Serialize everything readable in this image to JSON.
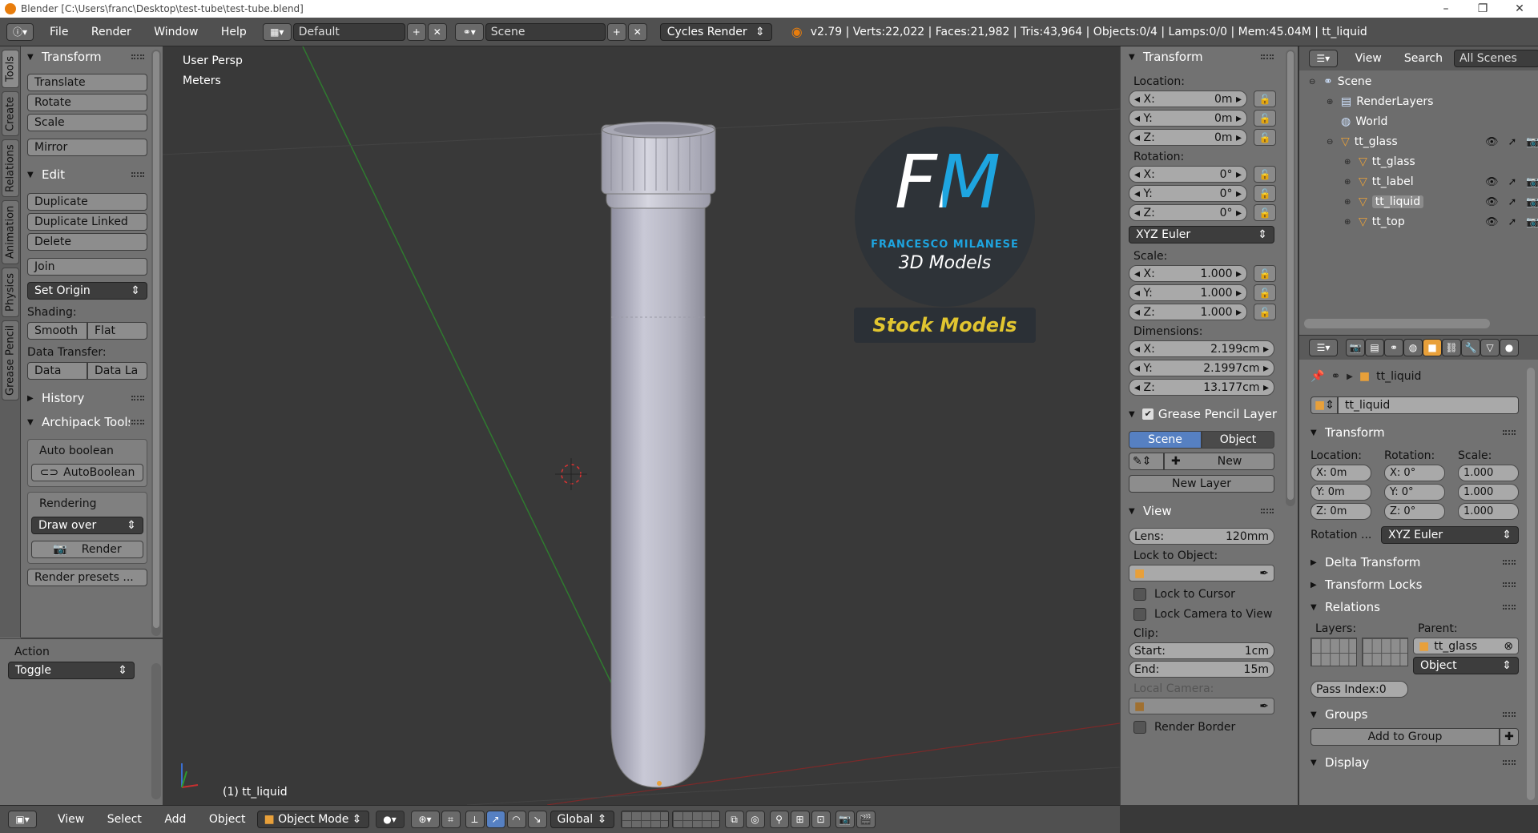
{
  "title_bar": {
    "text": "Blender [C:\\Users\\franc\\Desktop\\test-tube\\test-tube.blend]",
    "minimize": "–",
    "maximize": "❐",
    "close": "✕"
  },
  "info": {
    "menus": [
      "File",
      "Render",
      "Window",
      "Help"
    ],
    "layout": "Default",
    "scene": "Scene",
    "engine": "Cycles Render",
    "stats": "v2.79 | Verts:22,022 | Faces:21,982 | Tris:43,964 | Objects:0/4 | Lamps:0/0 | Mem:45.04M | tt_liquid"
  },
  "tool_tabs": [
    "Tools",
    "Create",
    "Relations",
    "Animation",
    "Physics",
    "Grease Pencil"
  ],
  "toolshelf": {
    "transform": {
      "title": "Transform",
      "buttons": [
        "Translate",
        "Rotate",
        "Scale",
        "Mirror"
      ]
    },
    "edit": {
      "title": "Edit",
      "buttons": [
        "Duplicate",
        "Duplicate Linked",
        "Delete",
        "Join"
      ],
      "set_origin": "Set Origin",
      "shading_label": "Shading:",
      "smooth": "Smooth",
      "flat": "Flat",
      "data_transfer_label": "Data Transfer:",
      "data": "Data",
      "data_la": "Data La"
    },
    "history": "History",
    "archipack": {
      "title": "Archipack Tools",
      "auto_boolean": "Auto boolean",
      "autoboolean_btn": "AutoBoolean",
      "rendering": "Rendering",
      "draw_over": "Draw over",
      "render": "Render",
      "render_presets": "Render presets ..."
    },
    "operator": {
      "title": "Action",
      "value": "Toggle"
    }
  },
  "viewport": {
    "mode_text": "User Persp",
    "units_text": "Meters",
    "object_text": "(1) tt_liquid",
    "logo": {
      "letters": "FM",
      "name": "FRANCESCO MILANESE",
      "sub": "3D Models",
      "stock": "Stock Models"
    }
  },
  "properties_n": {
    "transform_title": "Transform",
    "location_label": "Location:",
    "location": [
      {
        "axis": "X:",
        "value": "0m"
      },
      {
        "axis": "Y:",
        "value": "0m"
      },
      {
        "axis": "Z:",
        "value": "0m"
      }
    ],
    "rotation_label": "Rotation:",
    "rotation": [
      {
        "axis": "X:",
        "value": "0°"
      },
      {
        "axis": "Y:",
        "value": "0°"
      },
      {
        "axis": "Z:",
        "value": "0°"
      }
    ],
    "rotation_mode": "XYZ Euler",
    "scale_label": "Scale:",
    "scale": [
      {
        "axis": "X:",
        "value": "1.000"
      },
      {
        "axis": "Y:",
        "value": "1.000"
      },
      {
        "axis": "Z:",
        "value": "1.000"
      }
    ],
    "dimensions_label": "Dimensions:",
    "dimensions": [
      {
        "axis": "X:",
        "value": "2.199cm"
      },
      {
        "axis": "Y:",
        "value": "2.1997cm"
      },
      {
        "axis": "Z:",
        "value": "13.177cm"
      }
    ],
    "gp_title": "Grease Pencil Layer",
    "gp_scene": "Scene",
    "gp_object": "Object",
    "gp_new": "New",
    "gp_new_layer": "New Layer",
    "view_title": "View",
    "lens_label": "Lens:",
    "lens_value": "120mm",
    "lock_to_object": "Lock to Object:",
    "lock_to_cursor": "Lock to Cursor",
    "lock_camera": "Lock Camera to View",
    "clip_label": "Clip:",
    "clip_start_label": "Start:",
    "clip_start": "1cm",
    "clip_end_label": "End:",
    "clip_end": "15m",
    "local_camera": "Local Camera:",
    "render_border": "Render Border"
  },
  "outliner": {
    "view": "View",
    "search": "Search",
    "filter": "All Scenes",
    "items": [
      {
        "label": "Scene",
        "depth": 0
      },
      {
        "label": "RenderLayers",
        "depth": 1
      },
      {
        "label": "World",
        "depth": 1
      },
      {
        "label": "tt_glass",
        "depth": 1
      },
      {
        "label": "tt_glass",
        "depth": 2
      },
      {
        "label": "tt_label",
        "depth": 2
      },
      {
        "label": "tt_liquid",
        "depth": 2
      },
      {
        "label": "tt_top",
        "depth": 2
      }
    ]
  },
  "props": {
    "context": "tt_liquid",
    "name_value": "tt_liquid",
    "transform_title": "Transform",
    "location_label": "Location:",
    "rotation_label": "Rotation:",
    "scale_label": "Scale:",
    "loc": [
      "X: 0m",
      "Y: 0m",
      "Z: 0m"
    ],
    "rot": [
      "X:",
      "Y:",
      "Z:"
    ],
    "rot_values": [
      "0°",
      "0°",
      "0°"
    ],
    "scl": [
      "1.000",
      "1.000",
      "1.000"
    ],
    "rotation_mode_label": "Rotation ...",
    "rotation_mode": "XYZ Euler",
    "delta": "Delta Transform",
    "locks": "Transform Locks",
    "relations": "Relations",
    "layers_label": "Layers:",
    "parent_label": "Parent:",
    "parent": "tt_glass",
    "parent_type": "Object",
    "pass_index": "Pass Index:0",
    "groups": "Groups",
    "add_to_group": "Add to Group",
    "display": "Display"
  },
  "footer": {
    "menus": [
      "View",
      "Select",
      "Add",
      "Object"
    ],
    "mode": "Object Mode",
    "orientation": "Global"
  }
}
